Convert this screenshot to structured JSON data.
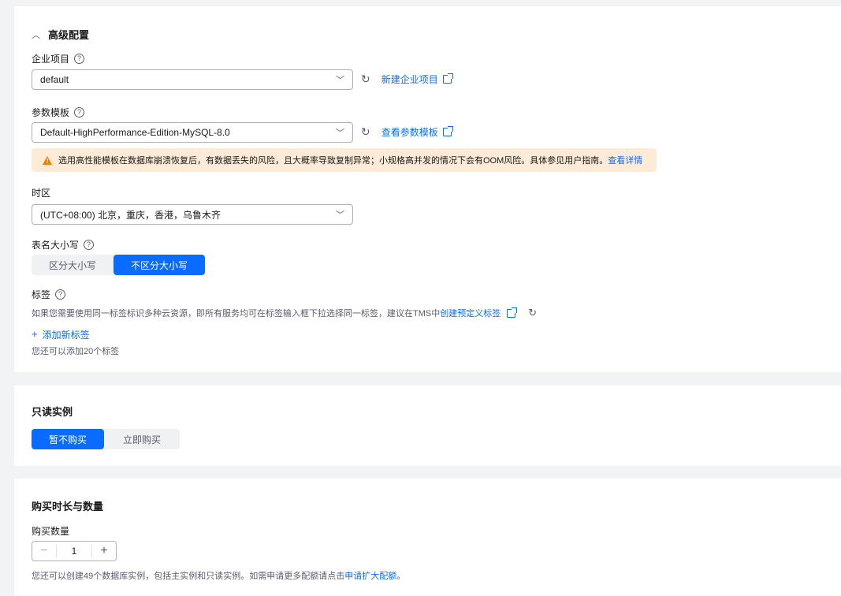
{
  "advanced": {
    "title": "高级配置",
    "enterprise": {
      "label": "企业项目",
      "value": "default",
      "link": "新建企业项目"
    },
    "param_template": {
      "label": "参数模板",
      "value": "Default-HighPerformance-Edition-MySQL-8.0",
      "link": "查看参数模板",
      "warning": "选用高性能模板在数据库崩溃恢复后，有数据丢失的风险，且大概率导致复制异常；小规格高并发的情况下会有OOM风险。具体参见用户指南。",
      "warning_link": "查看详情"
    },
    "timezone": {
      "label": "时区",
      "value": "(UTC+08:00) 北京，重庆，香港，乌鲁木齐"
    },
    "case": {
      "label": "表名大小写",
      "options": [
        "区分大小写",
        "不区分大小写"
      ],
      "selected": "不区分大小写"
    },
    "tags": {
      "label": "标签",
      "hint": "如果您需要使用同一标签标识多种云资源，即所有服务均可在标签输入框下拉选择同一标签，建议在TMS中",
      "hint_link": "创建预定义标签",
      "add": "添加新标签",
      "remaining": "您还可以添加20个标签"
    }
  },
  "readonly": {
    "title": "只读实例",
    "options": [
      "暂不购买",
      "立即购买"
    ],
    "selected": "暂不购买"
  },
  "purchase": {
    "title": "购买时长与数量",
    "qty_label": "购买数量",
    "qty_value": "1",
    "hint": "您还可以创建49个数据库实例，包括主实例和只读实例。如需申请更多配额请点击",
    "hint_link": "申请扩大配额",
    "hint_end": "。"
  },
  "icons": {
    "help": "?",
    "refresh": "↻",
    "chevron": "﹀",
    "collapse": "︿",
    "minus": "−",
    "plus": "+"
  },
  "colors": {
    "accent": "#0a6cff",
    "warning_bg": "#fdebd8",
    "warning_icon": "#f47c00"
  }
}
